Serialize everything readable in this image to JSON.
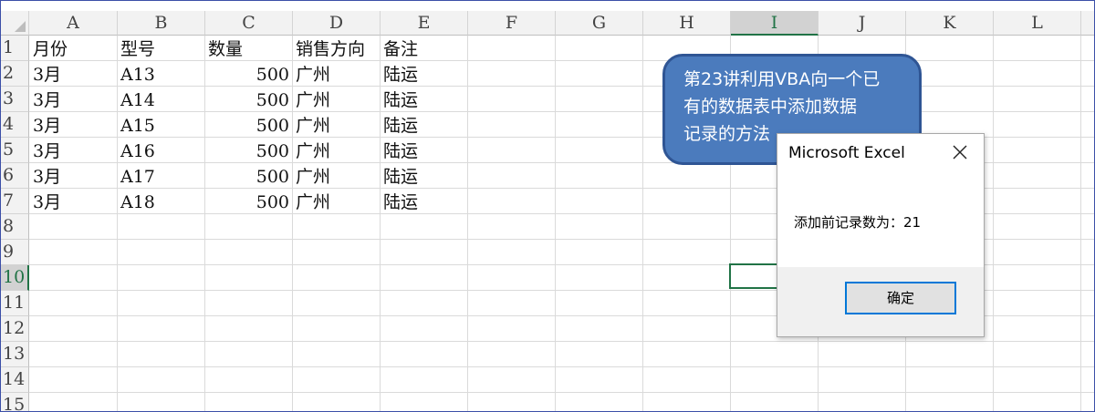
{
  "columns": [
    "A",
    "B",
    "C",
    "D",
    "E",
    "F",
    "G",
    "H",
    "I",
    "J",
    "K",
    "L"
  ],
  "selected_column": "I",
  "rows": [
    "1",
    "2",
    "3",
    "4",
    "5",
    "6",
    "7",
    "8",
    "9",
    "10",
    "11",
    "12",
    "13",
    "14",
    "15"
  ],
  "selected_row": "10",
  "sheet": {
    "headers": [
      "月份",
      "型号",
      "数量",
      "销售方向",
      "备注"
    ],
    "records": [
      [
        "3月",
        "A13",
        "500",
        "广州",
        "陆运"
      ],
      [
        "3月",
        "A14",
        "500",
        "广州",
        "陆运"
      ],
      [
        "3月",
        "A15",
        "500",
        "广州",
        "陆运"
      ],
      [
        "3月",
        "A16",
        "500",
        "广州",
        "陆运"
      ],
      [
        "3月",
        "A17",
        "500",
        "广州",
        "陆运"
      ],
      [
        "3月",
        "A18",
        "500",
        "广州",
        "陆运"
      ]
    ]
  },
  "callout": {
    "line1": "第23讲利用VBA向一个已",
    "line2": "有的数据表中添加数据",
    "line3": "记录的方法"
  },
  "dialog": {
    "title": "Microsoft Excel",
    "message": "添加前记录数为：21",
    "ok_label": "确定",
    "close_icon": "close-icon"
  },
  "colors": {
    "accent_green": "#217346",
    "callout_fill": "#4b7bbd",
    "dialog_button_border": "#0078d7"
  }
}
